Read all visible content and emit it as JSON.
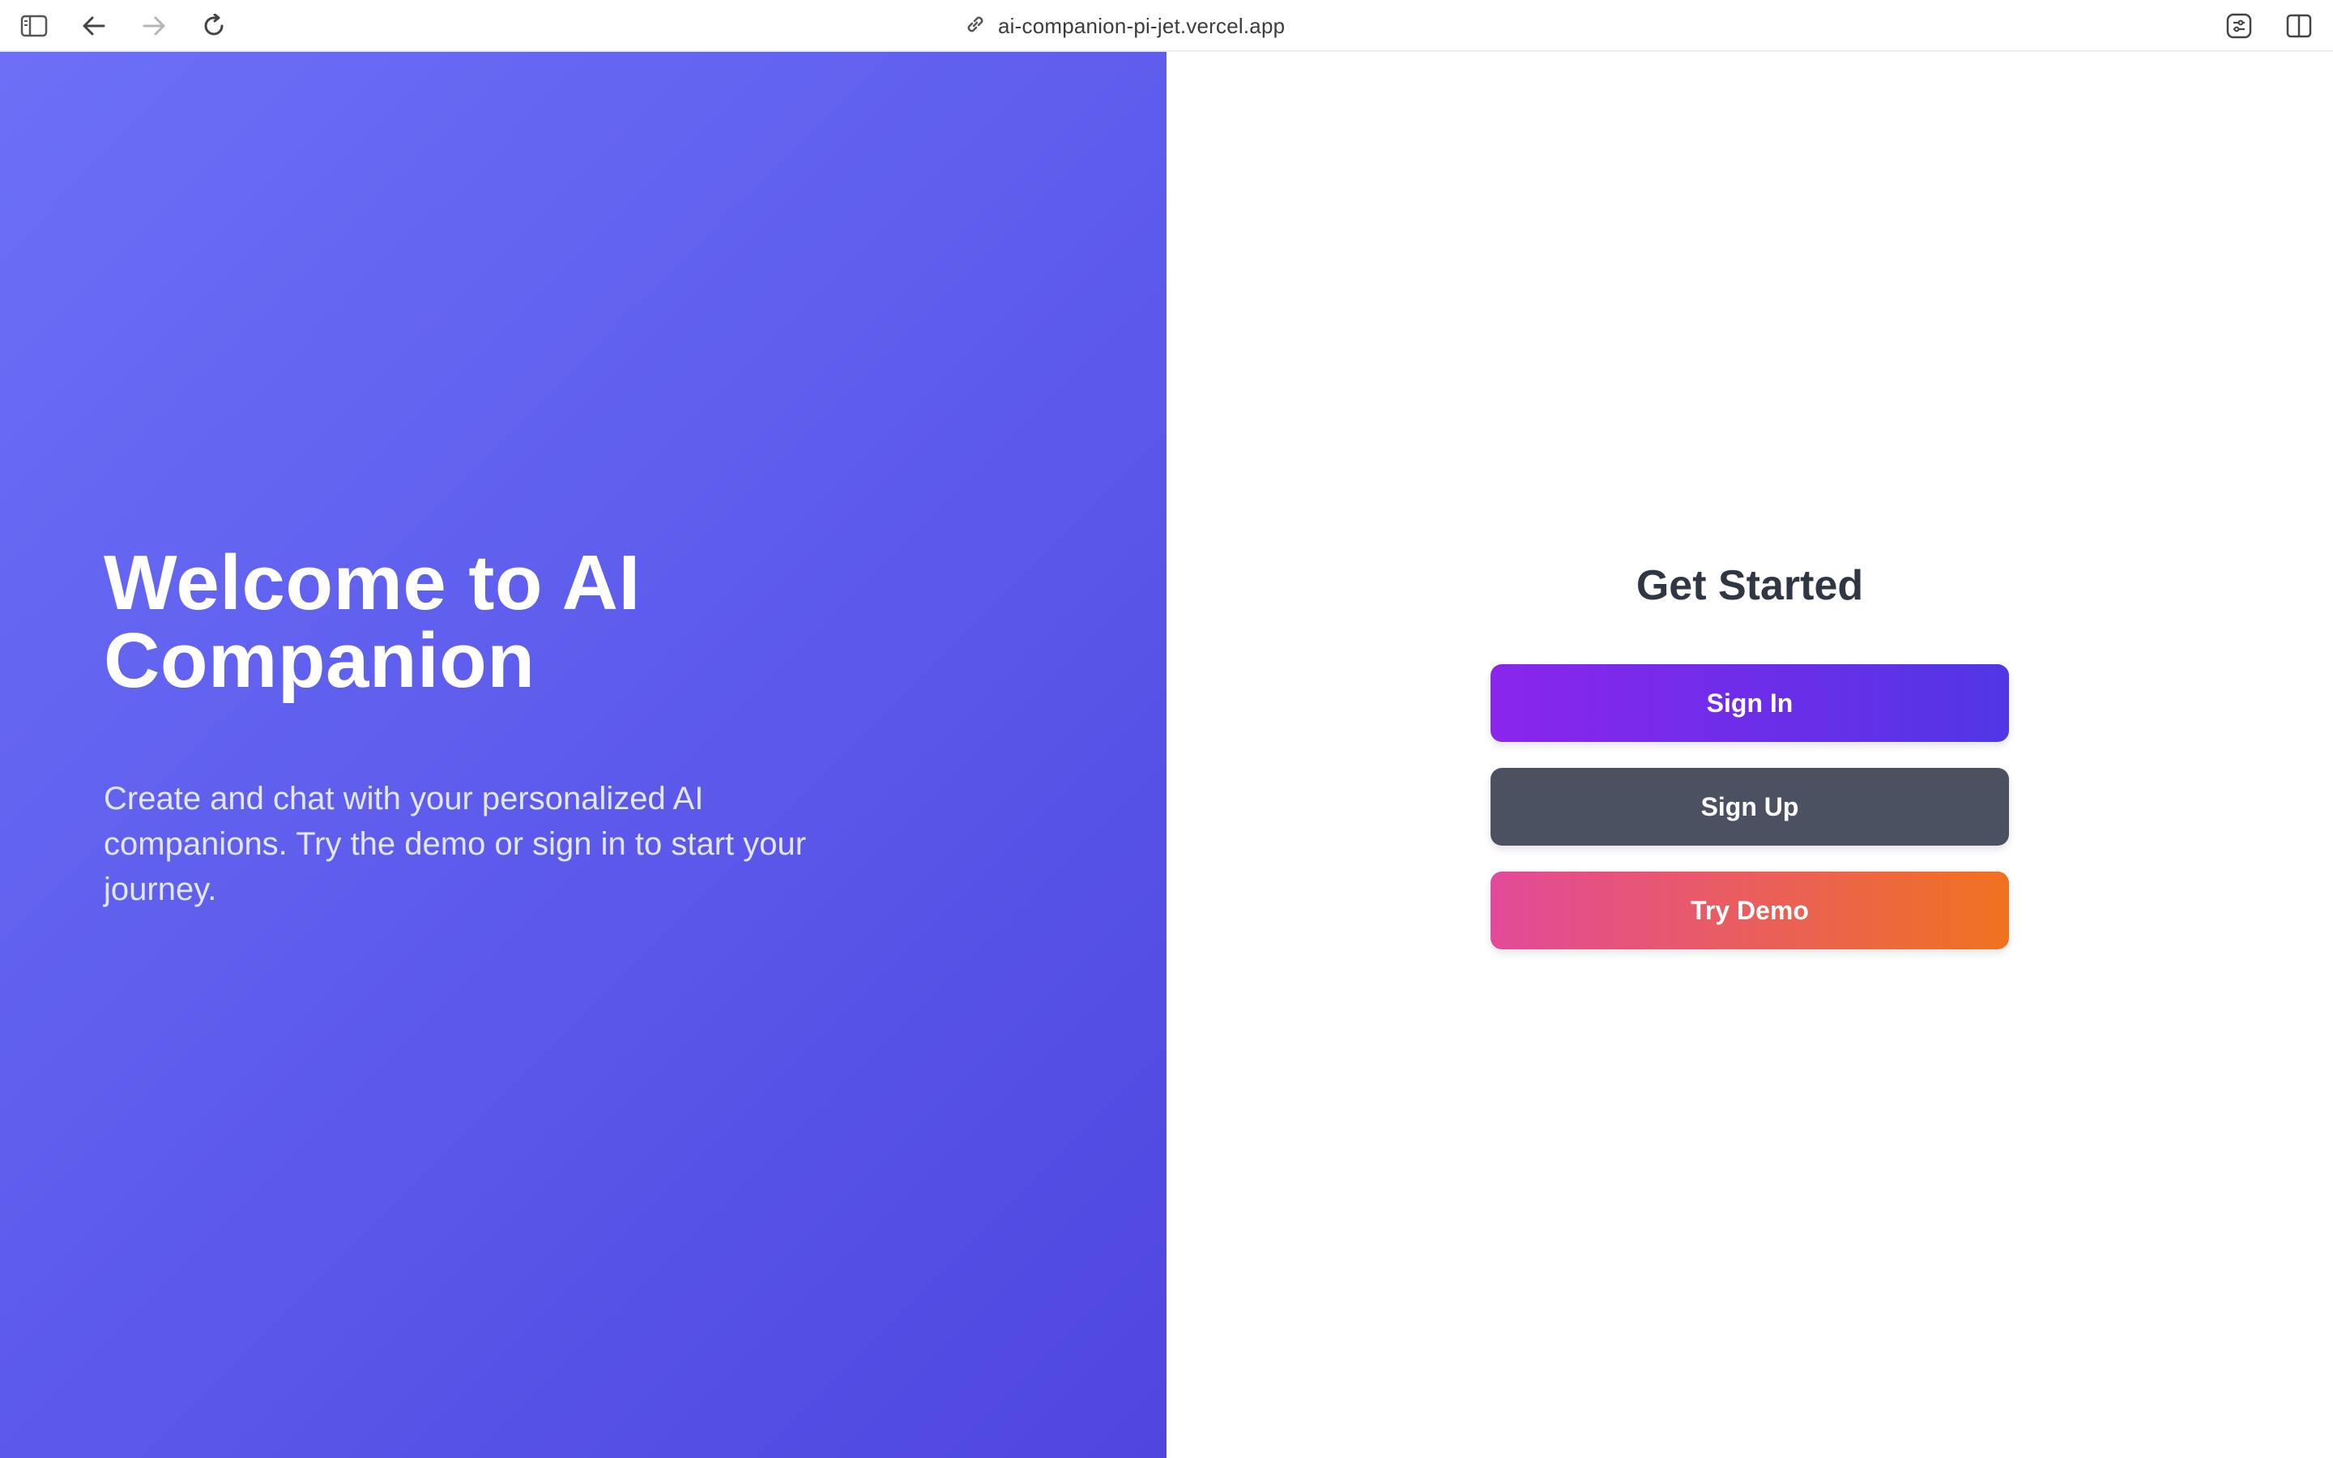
{
  "browser": {
    "url": "ai-companion-pi-jet.vercel.app",
    "icons": {
      "sidebar": "sidebar-toggle-icon",
      "back": "back-arrow-icon",
      "forward": "forward-arrow-icon",
      "reload": "reload-icon",
      "link": "link-icon",
      "extensions": "extensions-icon",
      "split_view": "split-view-icon"
    }
  },
  "hero": {
    "title": "Welcome to AI Companion",
    "subtitle": "Create and chat with your personalized AI companions. Try the demo or sign in to start your journey.",
    "gradient_start": "#6b70f7",
    "gradient_end": "#4f46e0"
  },
  "auth": {
    "heading": "Get Started",
    "sign_in_label": "Sign In",
    "sign_up_label": "Sign Up",
    "try_demo_label": "Try Demo",
    "colors": {
      "sign_in_start": "#8a25ec",
      "sign_in_end": "#5136e6",
      "sign_up": "#4b5160",
      "demo_start": "#e24a9a",
      "demo_end": "#f0721f"
    }
  }
}
